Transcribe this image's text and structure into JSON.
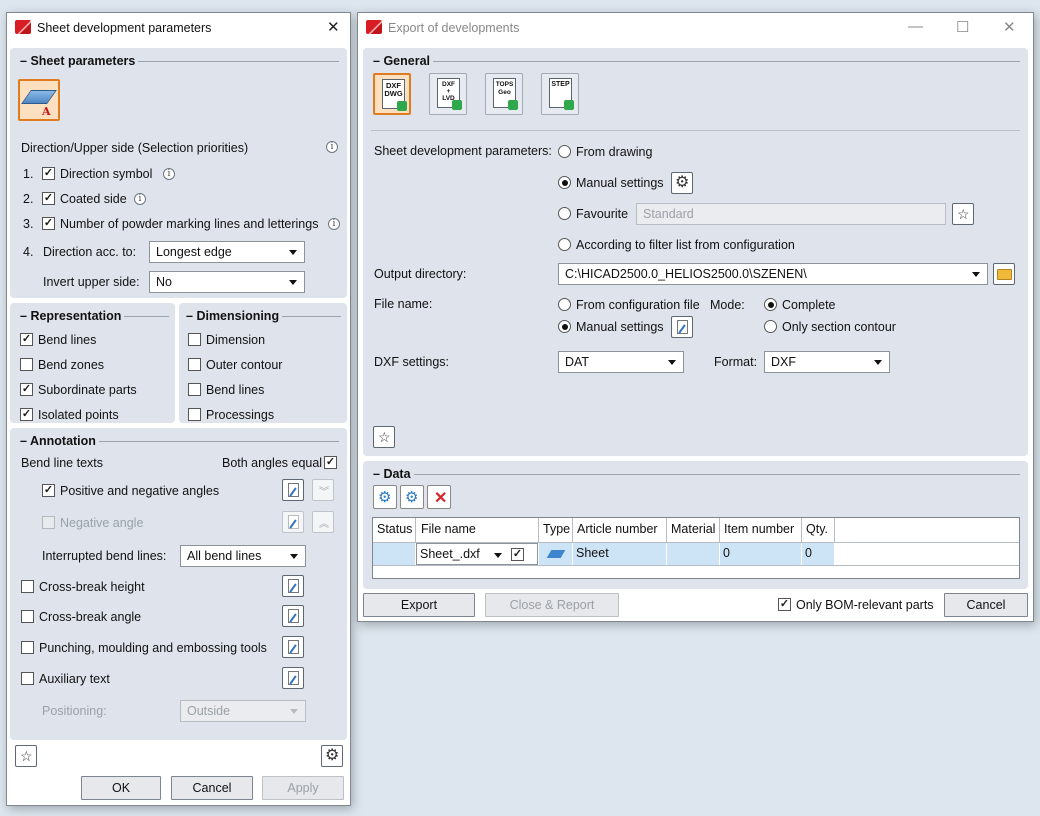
{
  "left_window": {
    "title": "Sheet development parameters",
    "sheet_parameters": {
      "title": "Sheet parameters",
      "tile_letter": "A",
      "priorities_label": "Direction/Upper side (Selection priorities)",
      "items": [
        {
          "num": "1.",
          "label": "Direction symbol",
          "checked": true
        },
        {
          "num": "2.",
          "label": "Coated side",
          "checked": true
        },
        {
          "num": "3.",
          "label": "Number of powder marking lines and letterings",
          "checked": true
        }
      ],
      "direction_num": "4.",
      "direction_label": "Direction acc. to:",
      "direction_value": "Longest edge",
      "invert_label": "Invert upper side:",
      "invert_value": "No"
    },
    "representation": {
      "title": "Representation",
      "items": [
        {
          "label": "Bend lines",
          "checked": true
        },
        {
          "label": "Bend zones",
          "checked": false
        },
        {
          "label": "Subordinate parts",
          "checked": true
        },
        {
          "label": "Isolated points",
          "checked": true
        }
      ]
    },
    "dimensioning": {
      "title": "Dimensioning",
      "items": [
        {
          "label": "Dimension",
          "checked": false
        },
        {
          "label": "Outer contour",
          "checked": false
        },
        {
          "label": "Bend lines",
          "checked": false
        },
        {
          "label": "Processings",
          "checked": false
        }
      ]
    },
    "annotation": {
      "title": "Annotation",
      "bend_line_texts": "Bend line texts",
      "both_angles_equal": "Both angles equal",
      "positive_negative": "Positive and negative angles",
      "negative_angle": "Negative angle",
      "interrupted_label": "Interrupted bend lines:",
      "interrupted_value": "All bend lines",
      "cross_break_height": "Cross-break height",
      "cross_break_angle": "Cross-break angle",
      "punching": "Punching, moulding and embossing tools",
      "auxiliary_text": "Auxiliary text",
      "positioning_label": "Positioning:",
      "positioning_value": "Outside"
    },
    "buttons": {
      "ok": "OK",
      "cancel": "Cancel",
      "apply": "Apply"
    }
  },
  "right_window": {
    "title": "Export of developments",
    "general_title": "General",
    "export_types": [
      {
        "label": "DXF\nDWG",
        "active": true
      },
      {
        "label": "DXF\n+\nLVD",
        "active": false
      },
      {
        "label": "TOPS\nGeo",
        "active": false
      },
      {
        "label": "STEP",
        "active": false
      }
    ],
    "sdp_label": "Sheet development parameters:",
    "sdp_options": {
      "from_drawing": "From drawing",
      "manual": "Manual settings",
      "favourite": "Favourite",
      "favourite_value": "Standard",
      "filter_list": "According to filter list from configuration"
    },
    "output_dir_label": "Output directory:",
    "output_dir_value": "C:\\HICAD2500.0_HELIOS2500.0\\SZENEN\\",
    "file_name_label": "File name:",
    "file_name_options": {
      "from_config": "From configuration file",
      "manual": "Manual settings"
    },
    "mode_label": "Mode:",
    "mode_options": {
      "complete": "Complete",
      "section_contour": "Only section contour"
    },
    "dxf_settings_label": "DXF settings:",
    "dxf_settings_value": "DAT",
    "format_label": "Format:",
    "format_value": "DXF",
    "data_title": "Data",
    "table": {
      "headers": [
        "Status",
        "File name",
        "Type",
        "Article number",
        "Material",
        "Item number",
        "Qty."
      ],
      "row": {
        "status": "",
        "file_name": "Sheet_.dxf",
        "type": "",
        "article_number": "Sheet",
        "material": "",
        "item_number": "0",
        "qty": "0"
      }
    },
    "buttons": {
      "export": "Export",
      "close_report": "Close & Report",
      "only_bom": "Only BOM-relevant parts",
      "cancel": "Cancel"
    }
  },
  "colors": {
    "panel_bg": "#dfe4ec",
    "active_tile": "#fde0c0",
    "active_tile_border": "#e07b1f",
    "selected_cell": "#cde4f7",
    "brand_red": "#d81e24"
  }
}
